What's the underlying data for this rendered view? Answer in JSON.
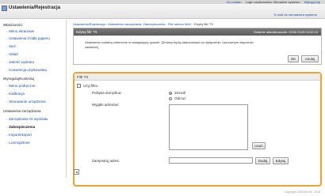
{
  "top": {
    "home": "Do portalu",
    "user": "Login użytkownika: Menadżer systemu",
    "logout": "Wyloguj się"
  },
  "header": {
    "title": "Ustawienia/Rejestracja",
    "mail_link": "E-mail do menadżera systemu"
  },
  "sidebar": {
    "preferences_heading": "Właściwości",
    "preferences": [
      "Menu ekranowe",
      "Ustawienia źródła papieru",
      "Sieć",
      "Układ",
      "Jakość wydruku",
      "Konwencja użytkownika"
    ],
    "adjust_heading": "Wyreguluj/Kontroluj",
    "adjust": [
      "Menu podręczne",
      "Kalibracja",
      "Stosowanie urządzenia"
    ],
    "management_heading": "Ustawienia zarządzania",
    "management": [
      "Zarządzanie ID wydziału",
      "Zabezpieczenia",
      "Import/eksport",
      "Licencja/Inne"
    ]
  },
  "breadcrumb": {
    "root": "Ustawienia/Rejestracja",
    "sep": " : ",
    "crumbs": [
      "Ustawienia zarządzania: Zabezpieczenia",
      "Filtr adresu MAC",
      "Edytuj filtr TX"
    ]
  },
  "panel1": {
    "title": "Edytuj filtr TX",
    "updated": "Ostatnie aktualizowanie: 20/06 2015 04:02:15",
    "message": "Ustawienia zostaną zmienione w następujący sposób. [Zmiany będą zastosowane po wyłączeniu i ponownym włączeniu zasilania].",
    "ok": "OK",
    "cancel": "Anuluj"
  },
  "panel2": {
    "title": "Filtr TX",
    "use_filter": "Użyj filtru",
    "default_policy_label": "Polityka domyślna:",
    "allow": "Zezwól",
    "reject": "Odrzuć",
    "exceptions_label": "Wyjątki adresów:",
    "delete": "Usuń",
    "register_label": "Zarejestruj adres:",
    "register_value": "",
    "add": "Dodaj",
    "edit": "Edytuj"
  },
  "footer": {
    "copyright": "Copyright CANON INC. 2015"
  }
}
